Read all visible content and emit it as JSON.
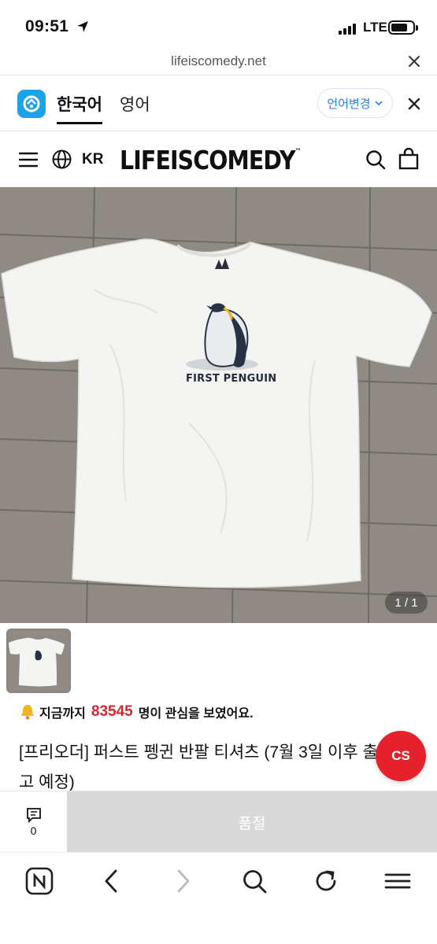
{
  "status_bar": {
    "time": "09:51",
    "network": "LTE"
  },
  "url_bar": {
    "url": "lifeiscomedy.net"
  },
  "translate_bar": {
    "lang_source": "한국어",
    "lang_target": "영어",
    "change_label": "언어변경"
  },
  "site_header": {
    "region": "KR",
    "brand": "LIFEISCOMEDY",
    "brand_mark": "™"
  },
  "hero": {
    "shirt_print": "FIRST PENGUIN",
    "pager": "1 / 1"
  },
  "interest": {
    "prefix": "지금까지",
    "count": "83545",
    "suffix": "명이 관심을 보였어요."
  },
  "product": {
    "title": "[프리오더] 퍼스트 펭귄 반팔 티셔츠 (7월 3일 이후 출고 예정)"
  },
  "cs": {
    "label": "CS"
  },
  "action_bar": {
    "chat_count": "0",
    "soldout_label": "품절"
  },
  "colors": {
    "accent_red": "#e5222c",
    "papago_blue": "#1fa3e8",
    "link_blue": "#2a7de1"
  }
}
